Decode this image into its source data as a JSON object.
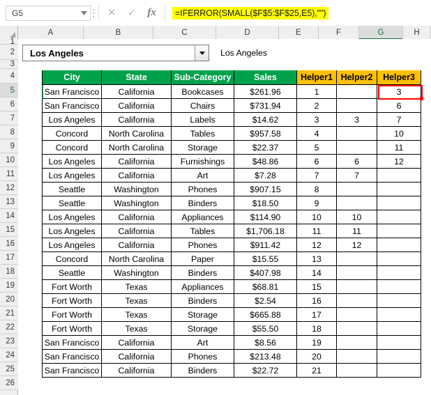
{
  "formula_bar": {
    "name_box_value": "G5",
    "name_box_icon": "chevron-down-icon",
    "cancel_icon": "close-icon",
    "confirm_icon": "check-icon",
    "function_icon": "fx-icon",
    "formula": "=IFERROR(SMALL($F$5:$F$25,E5),\"\")",
    "formula_highlight_color": "#FFFF00"
  },
  "grid": {
    "column_headers": [
      "A",
      "B",
      "C",
      "D",
      "E",
      "F",
      "G",
      "H"
    ],
    "selected_column": "G",
    "row_headers": [
      "1",
      "2",
      "3",
      "4",
      "5",
      "6",
      "7",
      "8",
      "9",
      "10",
      "11",
      "12",
      "13",
      "14",
      "15",
      "16",
      "17",
      "18",
      "19",
      "20",
      "21",
      "22",
      "23",
      "24",
      "25",
      "26"
    ],
    "selected_row": "5",
    "selected_cell": "G5"
  },
  "dropdown": {
    "value": "Los Angeles",
    "arrow_icon": "caret-down-icon"
  },
  "spill_text": {
    "value": "Los Angeles"
  },
  "table": {
    "header_color_primary": "#00A14B",
    "header_color_helper": "#FFC000",
    "headers": [
      "City",
      "State",
      "Sub-Category",
      "Sales",
      "Helper1",
      "Helper2",
      "Helper3"
    ],
    "rows": [
      {
        "row": "5",
        "city": "San Francisco",
        "state": "California",
        "subcategory": "Bookcases",
        "sales": "$261.96",
        "helper1": "1",
        "helper2": "",
        "helper3": "3"
      },
      {
        "row": "6",
        "city": "San Francisco",
        "state": "California",
        "subcategory": "Chairs",
        "sales": "$731.94",
        "helper1": "2",
        "helper2": "",
        "helper3": "6"
      },
      {
        "row": "7",
        "city": "Los Angeles",
        "state": "California",
        "subcategory": "Labels",
        "sales": "$14.62",
        "helper1": "3",
        "helper2": "3",
        "helper3": "7"
      },
      {
        "row": "8",
        "city": "Concord",
        "state": "North Carolina",
        "subcategory": "Tables",
        "sales": "$957.58",
        "helper1": "4",
        "helper2": "",
        "helper3": "10"
      },
      {
        "row": "9",
        "city": "Concord",
        "state": "North Carolina",
        "subcategory": "Storage",
        "sales": "$22.37",
        "helper1": "5",
        "helper2": "",
        "helper3": "11"
      },
      {
        "row": "10",
        "city": "Los Angeles",
        "state": "California",
        "subcategory": "Furnishings",
        "sales": "$48.86",
        "helper1": "6",
        "helper2": "6",
        "helper3": "12"
      },
      {
        "row": "11",
        "city": "Los Angeles",
        "state": "California",
        "subcategory": "Art",
        "sales": "$7.28",
        "helper1": "7",
        "helper2": "7",
        "helper3": ""
      },
      {
        "row": "12",
        "city": "Seattle",
        "state": "Washington",
        "subcategory": "Phones",
        "sales": "$907.15",
        "helper1": "8",
        "helper2": "",
        "helper3": ""
      },
      {
        "row": "13",
        "city": "Seattle",
        "state": "Washington",
        "subcategory": "Binders",
        "sales": "$18.50",
        "helper1": "9",
        "helper2": "",
        "helper3": ""
      },
      {
        "row": "14",
        "city": "Los Angeles",
        "state": "California",
        "subcategory": "Appliances",
        "sales": "$114.90",
        "helper1": "10",
        "helper2": "10",
        "helper3": ""
      },
      {
        "row": "15",
        "city": "Los Angeles",
        "state": "California",
        "subcategory": "Tables",
        "sales": "$1,706.18",
        "helper1": "11",
        "helper2": "11",
        "helper3": ""
      },
      {
        "row": "16",
        "city": "Los Angeles",
        "state": "California",
        "subcategory": "Phones",
        "sales": "$911.42",
        "helper1": "12",
        "helper2": "12",
        "helper3": ""
      },
      {
        "row": "17",
        "city": "Concord",
        "state": "North Carolina",
        "subcategory": "Paper",
        "sales": "$15.55",
        "helper1": "13",
        "helper2": "",
        "helper3": ""
      },
      {
        "row": "18",
        "city": "Seattle",
        "state": "Washington",
        "subcategory": "Binders",
        "sales": "$407.98",
        "helper1": "14",
        "helper2": "",
        "helper3": ""
      },
      {
        "row": "19",
        "city": "Fort Worth",
        "state": "Texas",
        "subcategory": "Appliances",
        "sales": "$68.81",
        "helper1": "15",
        "helper2": "",
        "helper3": ""
      },
      {
        "row": "20",
        "city": "Fort Worth",
        "state": "Texas",
        "subcategory": "Binders",
        "sales": "$2.54",
        "helper1": "16",
        "helper2": "",
        "helper3": ""
      },
      {
        "row": "21",
        "city": "Fort Worth",
        "state": "Texas",
        "subcategory": "Storage",
        "sales": "$665.88",
        "helper1": "17",
        "helper2": "",
        "helper3": ""
      },
      {
        "row": "22",
        "city": "Fort Worth",
        "state": "Texas",
        "subcategory": "Storage",
        "sales": "$55.50",
        "helper1": "18",
        "helper2": "",
        "helper3": ""
      },
      {
        "row": "23",
        "city": "San Francisco",
        "state": "California",
        "subcategory": "Art",
        "sales": "$8.56",
        "helper1": "19",
        "helper2": "",
        "helper3": ""
      },
      {
        "row": "24",
        "city": "San Francisco",
        "state": "California",
        "subcategory": "Phones",
        "sales": "$213.48",
        "helper1": "20",
        "helper2": "",
        "helper3": ""
      },
      {
        "row": "25",
        "city": "San Francisco",
        "state": "California",
        "subcategory": "Binders",
        "sales": "$22.72",
        "helper1": "21",
        "helper2": "",
        "helper3": ""
      }
    ]
  },
  "selection": {
    "border_color": "#FF0000"
  }
}
